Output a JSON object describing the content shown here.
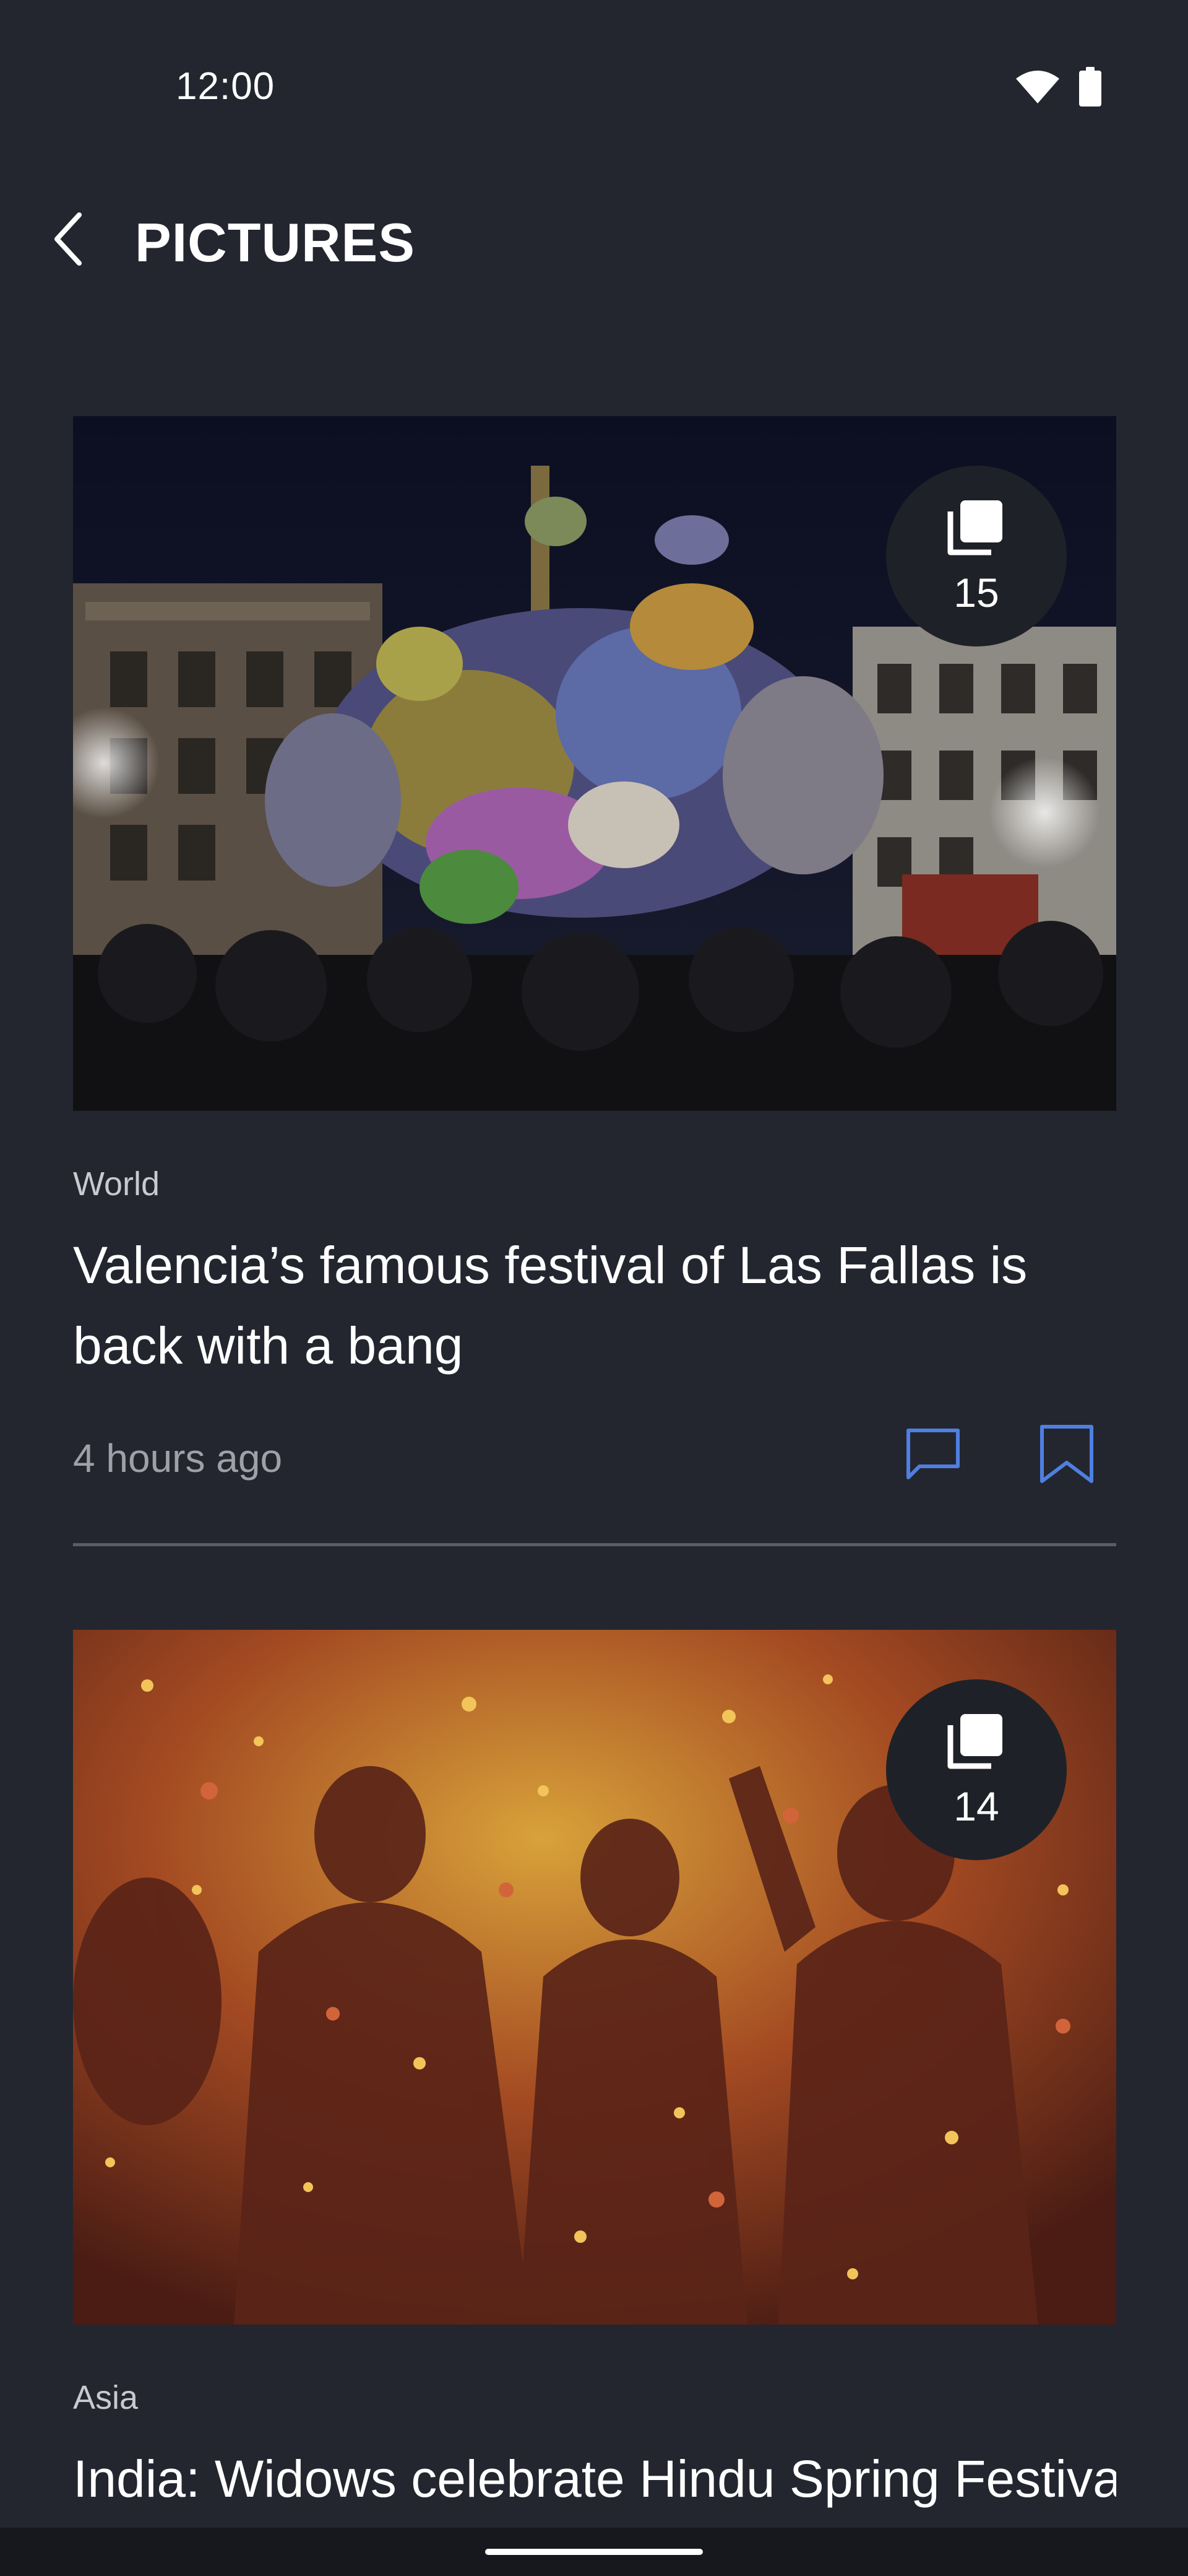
{
  "status_bar": {
    "time": "12:00",
    "icons": [
      "wifi-icon",
      "battery-icon"
    ]
  },
  "header": {
    "title": "PICTURES",
    "back_icon": "chevron-left-icon"
  },
  "articles": [
    {
      "image_subject": "Las Fallas festival sculpture at night",
      "photo_count": "15",
      "category": "World",
      "headline": "Valencia’s famous festival of Las Fallas is back with a bang",
      "timestamp": "4 hours ago"
    },
    {
      "image_subject": "Widows celebrating Holi with colored powder",
      "photo_count": "14",
      "category": "Asia",
      "headline": "India: Widows celebrate Hindu Spring Festival of"
    }
  ],
  "colors": {
    "background": "#23262f",
    "accent_icon": "#4f7fe0",
    "badge": "#1f2128",
    "divider": "#5a5d66"
  }
}
